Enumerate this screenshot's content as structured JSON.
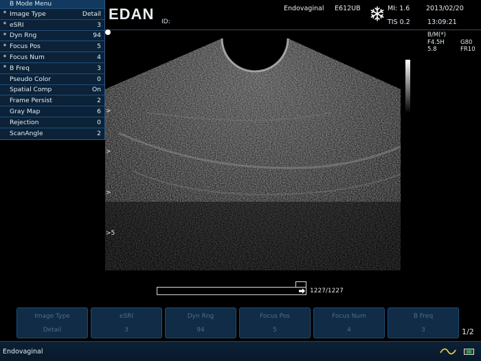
{
  "menu": {
    "title": "B Mode Menu",
    "items": [
      {
        "star": "*",
        "label": "Image Type",
        "value": "Detail"
      },
      {
        "star": "*",
        "label": "eSRI",
        "value": "3"
      },
      {
        "star": "*",
        "label": "Dyn Rng",
        "value": "94"
      },
      {
        "star": "*",
        "label": "Focus Pos",
        "value": "5"
      },
      {
        "star": "*",
        "label": "Focus Num",
        "value": "4"
      },
      {
        "star": "*",
        "label": "B Freq",
        "value": "3"
      },
      {
        "star": "",
        "label": "Pseudo Color",
        "value": "0"
      },
      {
        "star": "",
        "label": "Spatial Comp",
        "value": "On"
      },
      {
        "star": "",
        "label": "Frame Persist",
        "value": "2"
      },
      {
        "star": "",
        "label": "Gray Map",
        "value": "6"
      },
      {
        "star": "",
        "label": "Rejection",
        "value": "0"
      },
      {
        "star": "",
        "label": "ScanAngle",
        "value": "2"
      }
    ]
  },
  "header": {
    "logo": "EDAN",
    "id_label": "ID:",
    "exam": "Endovaginal",
    "probe": "E612UB",
    "mi": "MI: 1.6",
    "tis": "TIS 0.2",
    "date": "2013/02/20",
    "time": "13:09:21",
    "freeze_icon": "snowflake-icon"
  },
  "params": {
    "mode": "B/M(*)",
    "freq": "F4.5H",
    "gain": "G80",
    "depth": "5.8",
    "framerate": "FR10"
  },
  "depth_marks": [
    ">",
    ">",
    ">",
    ">5"
  ],
  "cine": {
    "counter": "1227/1227",
    "progress": 1.0
  },
  "softkeys": [
    {
      "title": "Image Type",
      "value": "Detail"
    },
    {
      "title": "eSRI",
      "value": "3"
    },
    {
      "title": "Dyn Rng",
      "value": "94"
    },
    {
      "title": "Focus Pos",
      "value": "5"
    },
    {
      "title": "Focus Num",
      "value": "4"
    },
    {
      "title": "B Freq",
      "value": "3"
    }
  ],
  "page_indicator": "1/2",
  "status": {
    "text": "Endovaginal",
    "icons": [
      "wave-icon",
      "usb-icon"
    ]
  },
  "colors": {
    "panel_bg": "#0b2238",
    "softkey_bg": "#102c46",
    "softkey_text": "#4d6f8e"
  }
}
